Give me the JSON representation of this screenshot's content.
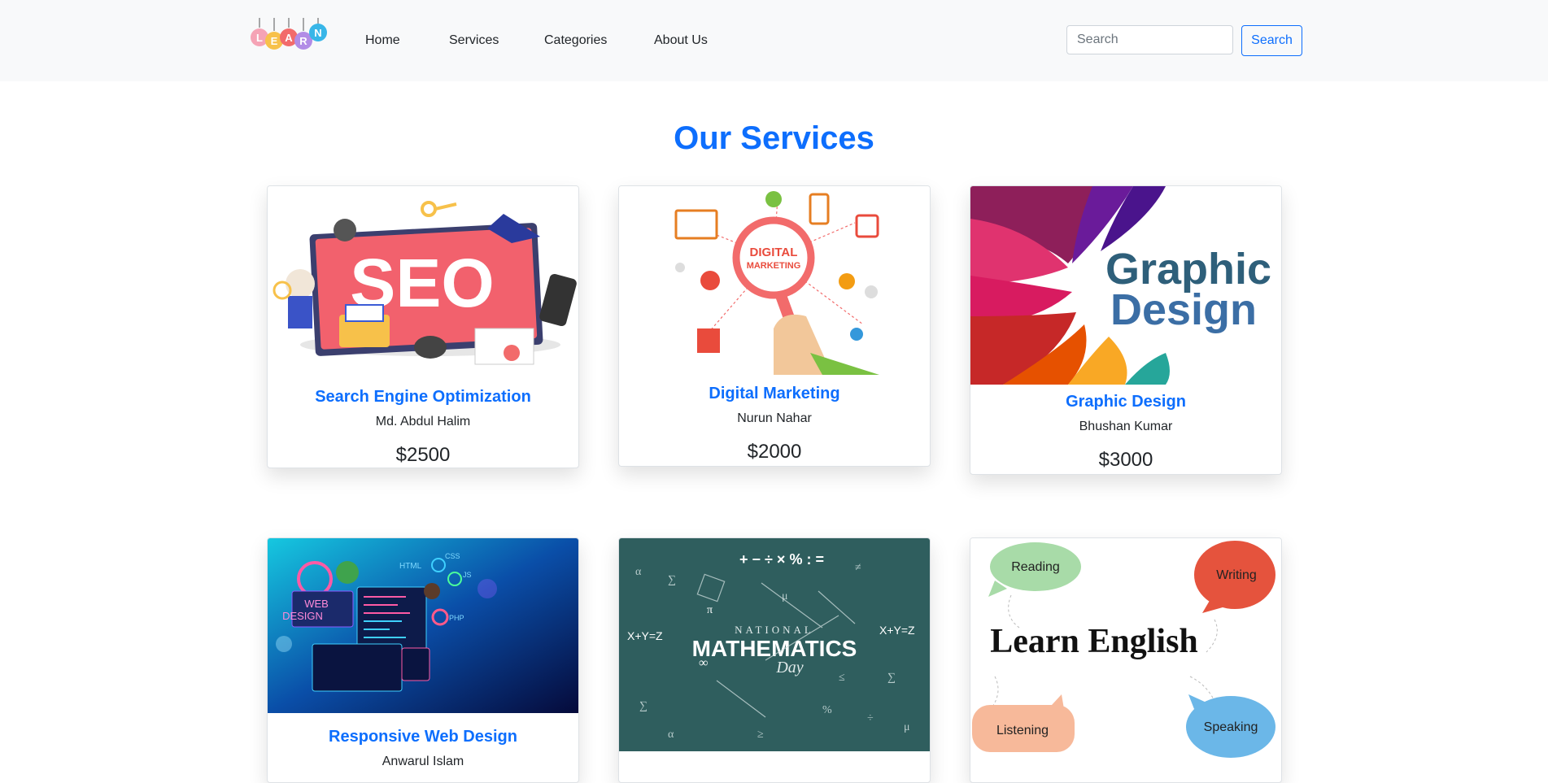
{
  "nav": {
    "logo_letters": [
      "L",
      "E",
      "A",
      "R",
      "N"
    ],
    "links": [
      "Home",
      "Services",
      "Categories",
      "About Us"
    ],
    "search_placeholder": "Search",
    "search_button": "Search"
  },
  "page_title": "Our Services",
  "services": [
    {
      "title": "Search Engine Optimization",
      "author": "Md. Abdul Halim",
      "price": "$2500",
      "image_text": "SEO"
    },
    {
      "title": "Digital Marketing",
      "author": "Nurun Nahar",
      "price": "$2000",
      "image_text": [
        "DIGITAL",
        "MARKETING"
      ]
    },
    {
      "title": "Graphic Design",
      "author": "Bhushan Kumar",
      "price": "$3000",
      "image_text": [
        "Graphic",
        "Design"
      ]
    },
    {
      "title": "Responsive Web Design",
      "author": "Anwarul Islam",
      "image_text": [
        "WEB",
        "DESIGN",
        "HTML",
        "CSS",
        "JS",
        "PHP"
      ]
    },
    {
      "image_text": [
        "+ − ÷ × % : =",
        "NATIONAL",
        "MATHEMATICS",
        "Day",
        "X+Y=Z",
        "X+Y=Z",
        "π",
        "∞"
      ]
    },
    {
      "image_text": [
        "Learn English",
        "Reading",
        "Writing",
        "Listening",
        "Speaking"
      ]
    }
  ],
  "colors": {
    "primary": "#0d6efd",
    "navbar_bg": "#f8f9fa"
  }
}
